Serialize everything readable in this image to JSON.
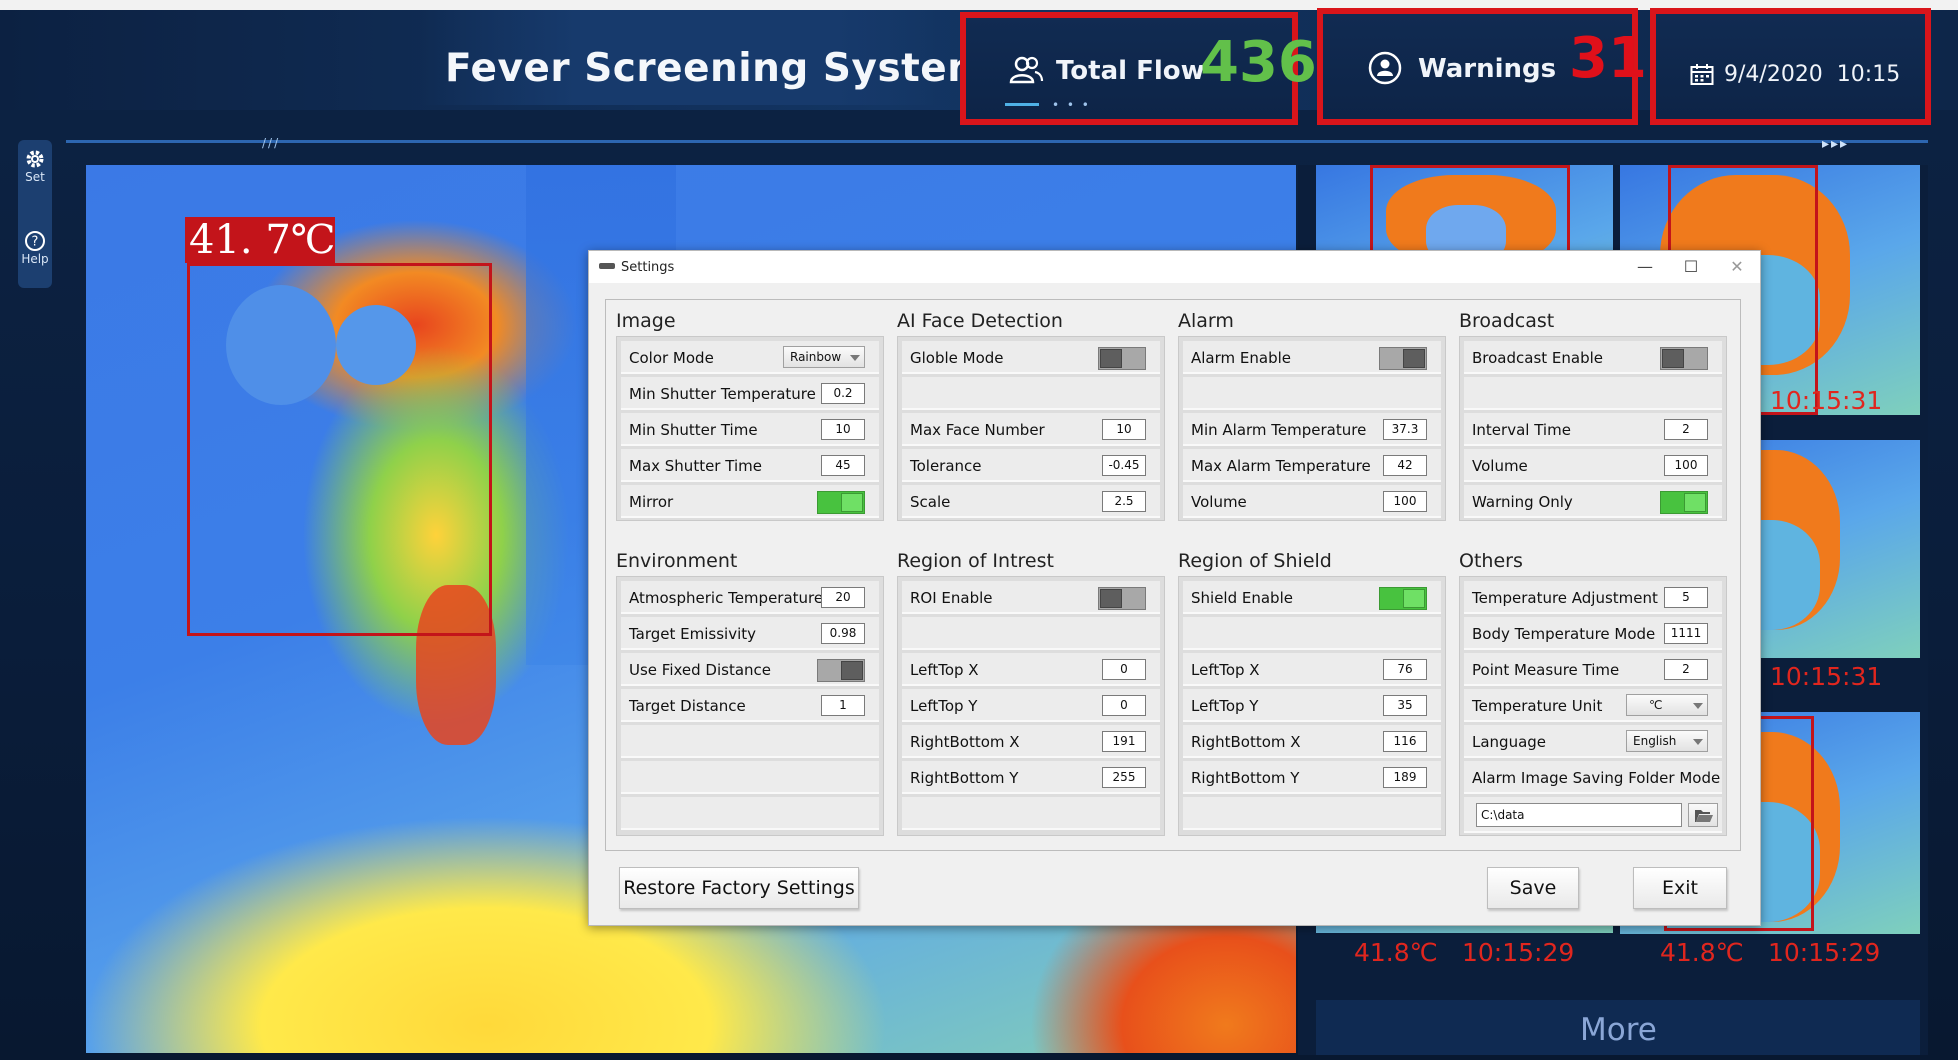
{
  "header": {
    "title": "Fever Screening System",
    "total_flow_label": "Total Flow",
    "total_flow_value": "436",
    "warnings_label": "Warnings",
    "warnings_value": "31",
    "datetime": "9/4/2020  10:15",
    "colors": {
      "flow": "#62c04a",
      "warnings": "#e0101a",
      "highlight": "#d9151b"
    }
  },
  "sidebar": {
    "set_label": "Set",
    "help_label": "Help"
  },
  "main": {
    "face_temperature": "41. 7℃"
  },
  "thumbnails": [
    {
      "time": "10:15:31"
    },
    {
      "time": "10:15:31"
    },
    {
      "temp": "41.8℃",
      "time": "10:15:29"
    },
    {
      "temp": "41.8℃",
      "time": "10:15:29"
    }
  ],
  "more_label": "More",
  "dialog": {
    "title": "Settings",
    "image": {
      "title": "Image",
      "color_mode_label": "Color Mode",
      "color_mode_value": "Rainbow",
      "min_shutter_temp_label": "Min Shutter Temperature",
      "min_shutter_temp": "0.2",
      "min_shutter_time_label": "Min Shutter Time",
      "min_shutter_time": "10",
      "max_shutter_time_label": "Max Shutter Time",
      "max_shutter_time": "45",
      "mirror_label": "Mirror"
    },
    "ai": {
      "title": "AI Face Detection",
      "globle_mode_label": "Globle Mode",
      "max_face_label": "Max Face Number",
      "max_face": "10",
      "tolerance_label": "Tolerance",
      "tolerance": "-0.45",
      "scale_label": "Scale",
      "scale": "2.5"
    },
    "alarm": {
      "title": "Alarm",
      "enable_label": "Alarm Enable",
      "min_label": "Min Alarm Temperature",
      "min": "37.3",
      "max_label": "Max Alarm Temperature",
      "max": "42",
      "volume_label": "Volume",
      "volume": "100"
    },
    "broadcast": {
      "title": "Broadcast",
      "enable_label": "Broadcast Enable",
      "interval_label": "Interval Time",
      "interval": "2",
      "volume_label": "Volume",
      "volume": "100",
      "warning_only_label": "Warning Only"
    },
    "environment": {
      "title": "Environment",
      "atm_label": "Atmospheric Temperature",
      "atm": "20",
      "emis_label": "Target Emissivity",
      "emis": "0.98",
      "fixed_label": "Use Fixed Distance",
      "dist_label": "Target Distance",
      "dist": "1"
    },
    "roi": {
      "title": "Region of Intrest",
      "enable_label": "ROI Enable",
      "ltx_label": "LeftTop X",
      "ltx": "0",
      "lty_label": "LeftTop Y",
      "lty": "0",
      "rbx_label": "RightBottom X",
      "rbx": "191",
      "rby_label": "RightBottom Y",
      "rby": "255"
    },
    "shield": {
      "title": "Region of Shield",
      "enable_label": "Shield Enable",
      "ltx_label": "LeftTop X",
      "ltx": "76",
      "lty_label": "LeftTop Y",
      "lty": "35",
      "rbx_label": "RightBottom X",
      "rbx": "116",
      "rby_label": "RightBottom Y",
      "rby": "189"
    },
    "others": {
      "title": "Others",
      "adj_label": "Temperature Adjustment",
      "adj": "5",
      "mode_label": "Body Temperature Mode",
      "mode": "1111",
      "pmt_label": "Point Measure Time",
      "pmt": "2",
      "unit_label": "Temperature Unit",
      "unit": "℃",
      "lang_label": "Language",
      "lang": "English",
      "folder_label": "Alarm Image Saving Folder Mode",
      "folder": "C:\\data"
    },
    "restore_label": "Restore Factory Settings",
    "save_label": "Save",
    "exit_label": "Exit"
  }
}
